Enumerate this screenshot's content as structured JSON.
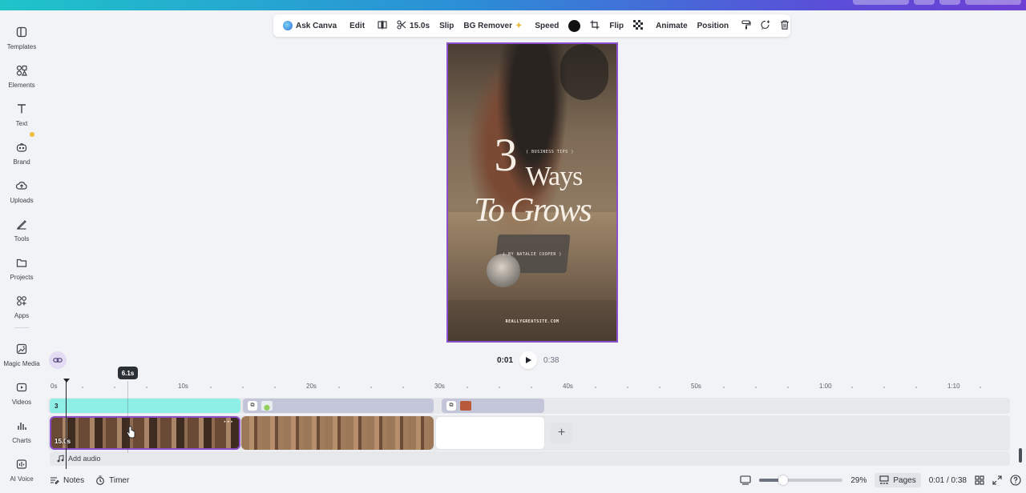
{
  "sidebar": {
    "items": [
      {
        "label": "Templates",
        "icon": "templates-icon"
      },
      {
        "label": "Elements",
        "icon": "elements-icon"
      },
      {
        "label": "Text",
        "icon": "text-icon"
      },
      {
        "label": "Brand",
        "icon": "brand-icon"
      },
      {
        "label": "Uploads",
        "icon": "uploads-icon"
      },
      {
        "label": "Tools",
        "icon": "tools-icon"
      },
      {
        "label": "Projects",
        "icon": "projects-icon"
      },
      {
        "label": "Apps",
        "icon": "apps-icon"
      },
      {
        "label": "Magic Media",
        "icon": "magic-media-icon"
      },
      {
        "label": "Videos",
        "icon": "videos-icon"
      },
      {
        "label": "Charts",
        "icon": "charts-icon"
      },
      {
        "label": "AI Voice",
        "icon": "ai-voice-icon"
      }
    ]
  },
  "toolbar": {
    "ask_canva": "Ask Canva",
    "edit": "Edit",
    "duration": "15.0s",
    "slip": "Slip",
    "bg_remover": "BG Remover",
    "speed": "Speed",
    "flip": "Flip",
    "animate": "Animate",
    "position": "Position",
    "color_swatch": "#111111"
  },
  "preview": {
    "tag_top": "( BUSINESS TIPS )",
    "big_number": "3",
    "word_ways": "Ways",
    "line_two": "To Grows",
    "byline": "( BY NATALIE COOPER )",
    "website": "REALLYGREATSITE.COM",
    "border_color": "#8b4fc9"
  },
  "playback": {
    "current": "0:01",
    "total": "0:38"
  },
  "timeline": {
    "tooltip": "6.1s",
    "ruler": [
      "0s",
      "10s",
      "20s",
      "30s",
      "40s",
      "50s",
      "1:00",
      "1:10"
    ],
    "text_clip_label": "3",
    "video_clip_duration": "15.0s",
    "clip_more": "···",
    "add_audio": "Add audio",
    "add_clip": "+"
  },
  "bottombar": {
    "notes": "Notes",
    "timer": "Timer",
    "zoom": "29%",
    "zoom_fraction": 0.29,
    "pages": "Pages",
    "time": "0:01 / 0:38"
  }
}
